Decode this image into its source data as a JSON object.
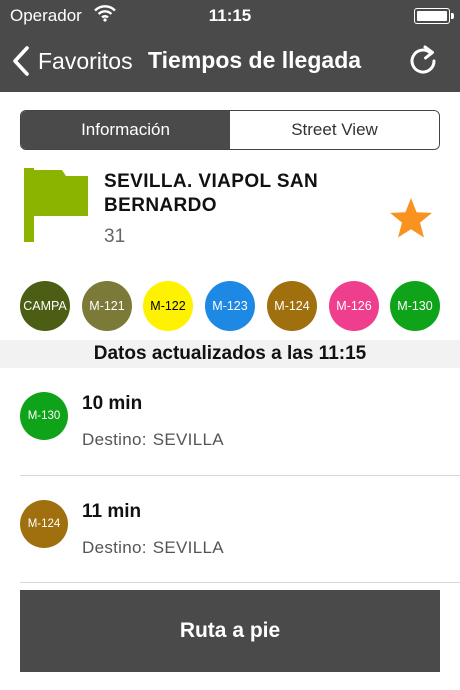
{
  "status_bar": {
    "carrier": "Operador",
    "time": "11:15",
    "icons": [
      "wifi-icon",
      "battery-icon"
    ]
  },
  "nav": {
    "back_label": "Favoritos",
    "title": "Tiempos de llegada",
    "back_icon": "chevron-left-icon",
    "refresh_icon": "refresh-icon"
  },
  "segments": {
    "info": "Información",
    "street_view": "Street View",
    "selected": "Información"
  },
  "stop": {
    "name": "SEVILLA. VIAPOL SAN BERNARDO",
    "code": "31",
    "flag_color": "#8ab400",
    "favorite": true,
    "star_color": "#f7931e"
  },
  "lines": [
    {
      "label": "CAMPA",
      "color": "#4b5e14",
      "text_color": "#ffffff"
    },
    {
      "label": "M-121",
      "color": "#7b7a38",
      "text_color": "#ffffff"
    },
    {
      "label": "M-122",
      "color": "#fff200",
      "text_color": "#000000"
    },
    {
      "label": "M-123",
      "color": "#1e88e5",
      "text_color": "#ffffff"
    },
    {
      "label": "M-124",
      "color": "#a0700f",
      "text_color": "#ffffff"
    },
    {
      "label": "M-126",
      "color": "#ee3e8d",
      "text_color": "#ffffff"
    },
    {
      "label": "M-130",
      "color": "#0fa319",
      "text_color": "#ffffff"
    }
  ],
  "updated_text": "Datos actualizados a las 11:15",
  "arrivals": [
    {
      "line": "M-130",
      "color": "#0fa319",
      "time": "10 min",
      "dest_label": "Destino:",
      "dest_value": "SEVILLA"
    },
    {
      "line": "M-124",
      "color": "#a0700f",
      "time": "11 min",
      "dest_label": "Destino:",
      "dest_value": "SEVILLA"
    }
  ],
  "route_button": "Ruta a pie"
}
